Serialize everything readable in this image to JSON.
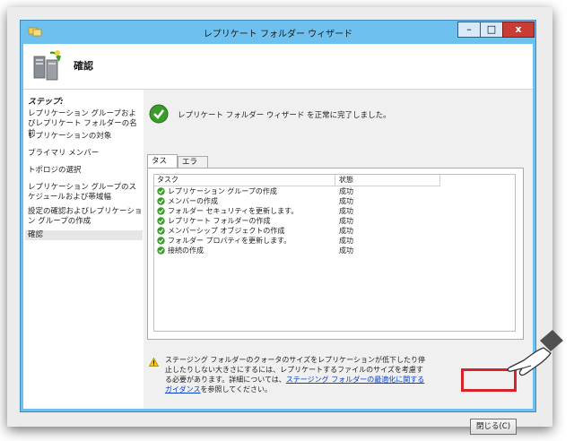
{
  "window": {
    "title": "レプリケート フォルダー ウィザード",
    "minimize_label": "–",
    "maximize_label": "□",
    "close_label": "x"
  },
  "header": {
    "title": "確認"
  },
  "steps": {
    "heading": "ステップ:",
    "items": [
      {
        "label": "レプリケーション グループおよびレプリケート フォルダーの名前"
      },
      {
        "label": "レプリケーションの対象"
      },
      {
        "label": "プライマリ メンバー"
      },
      {
        "label": "トポロジの選択"
      },
      {
        "label": "レプリケーション グループのスケジュールおよび帯域幅"
      },
      {
        "label": "設定の確認およびレプリケーション グループの作成"
      },
      {
        "label": "確認"
      }
    ]
  },
  "main": {
    "success_message": "レプリケート フォルダー ウィザード を正常に完了しました。",
    "tabs": [
      {
        "label": "タスク"
      },
      {
        "label": "エラー"
      }
    ],
    "columns": {
      "task": "タスク",
      "status": "状態"
    },
    "rows": [
      {
        "task": "レプリケーション グループの作成",
        "status": "成功"
      },
      {
        "task": "メンバーの作成",
        "status": "成功"
      },
      {
        "task": "フォルダー セキュリティを更新します。",
        "status": "成功"
      },
      {
        "task": "レプリケート フォルダーの作成",
        "status": "成功"
      },
      {
        "task": "メンバーシップ オブジェクトの作成",
        "status": "成功"
      },
      {
        "task": "フォルダー プロパティを更新します。",
        "status": "成功"
      },
      {
        "task": "接続の作成",
        "status": "成功"
      }
    ],
    "warning": {
      "text_before": "ステージング フォルダーのクォータのサイズをレプリケーションが低下したり停止したりしない大きさにするには、レプリケートするファイルのサイズを考慮する必要があります。詳細については、",
      "link": "ステージング フォルダーの最適化に関するガイダンス",
      "text_after": "を参照してください。"
    },
    "close_button": "閉じる(C)"
  },
  "colors": {
    "titlebar": "#6ec1ef",
    "close_highlight": "#d8232a",
    "link": "#0a41c8",
    "success_green": "#3a9a2a"
  }
}
